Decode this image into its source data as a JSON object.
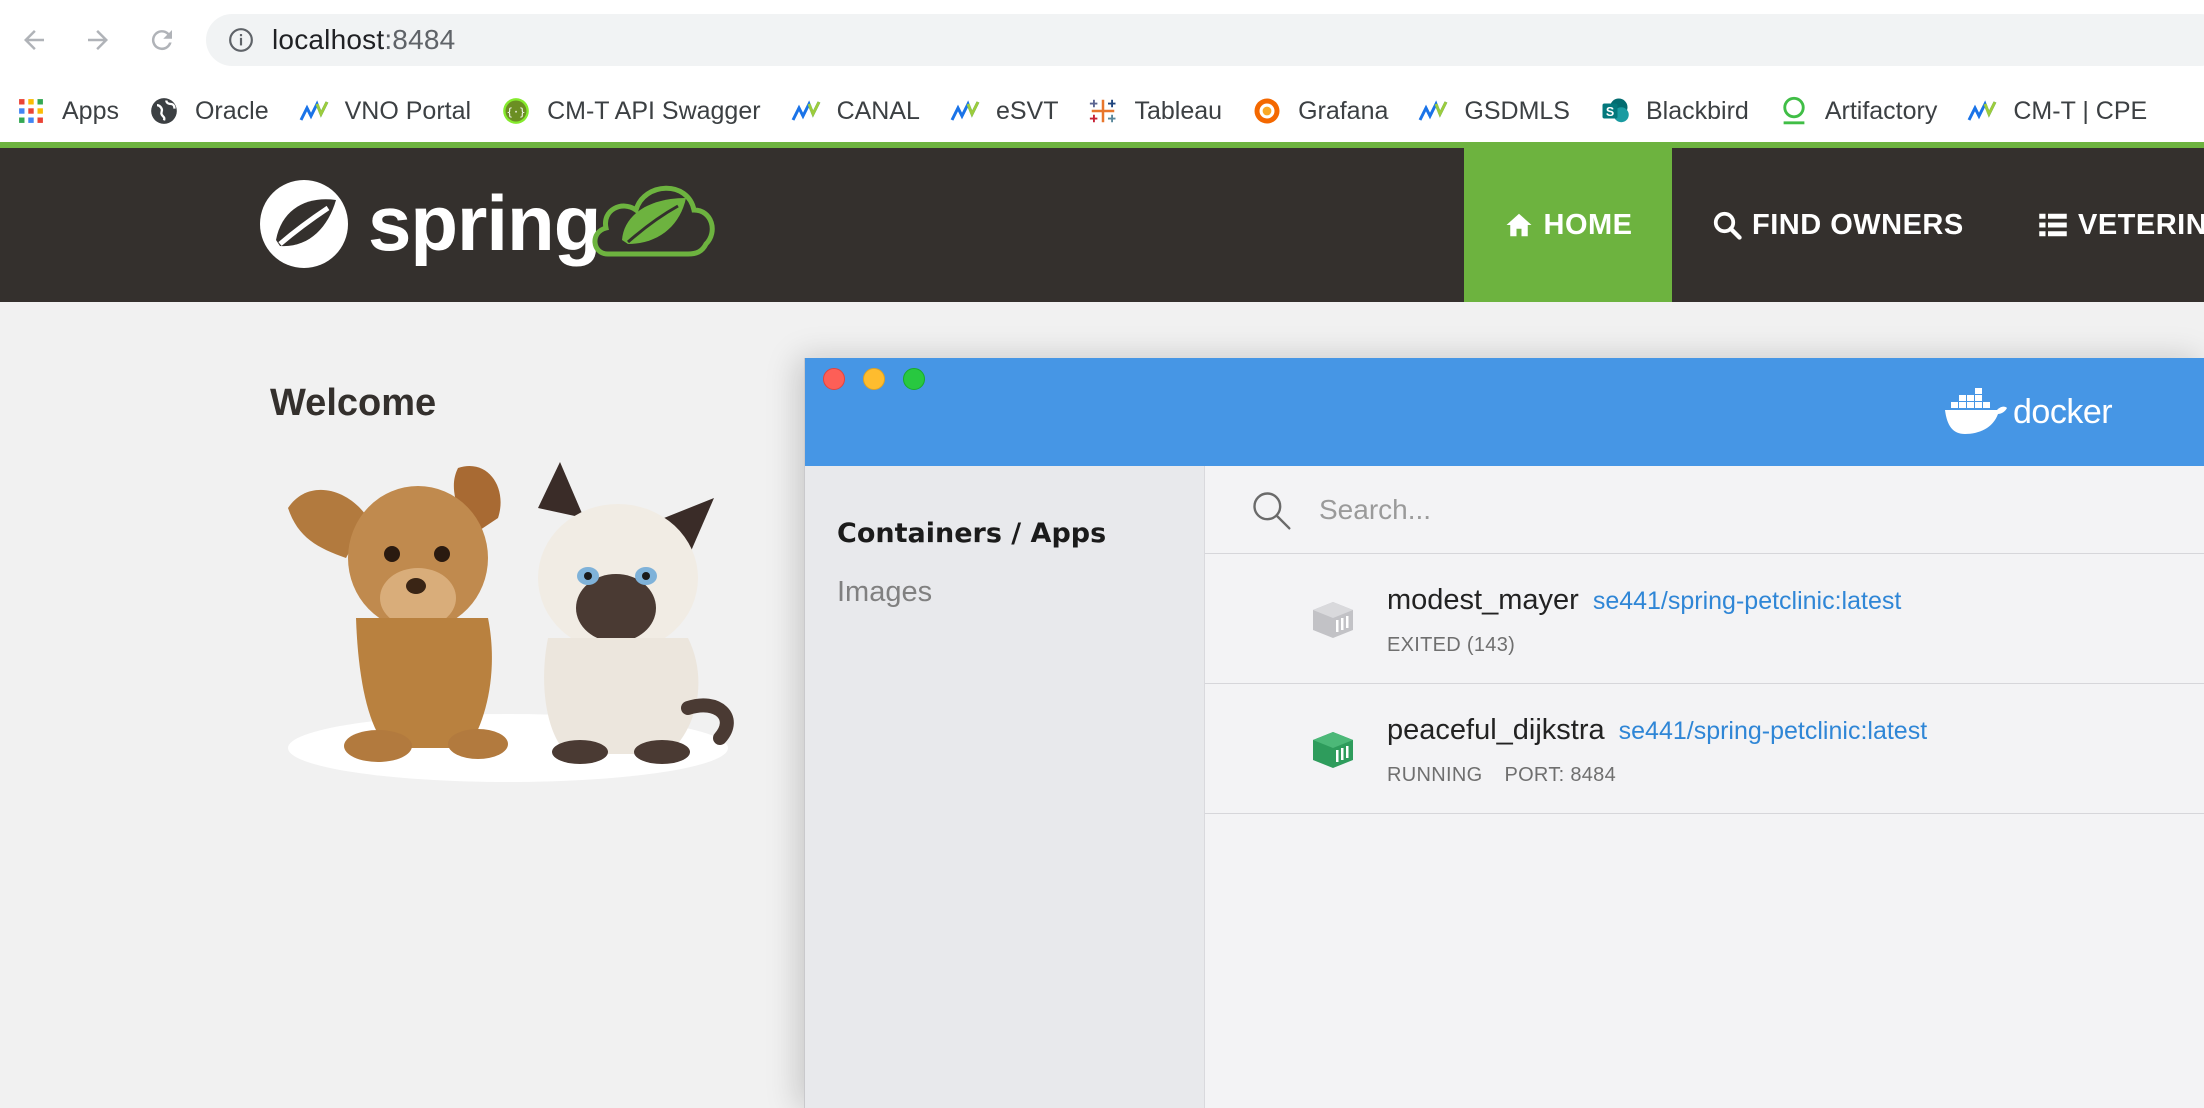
{
  "browser": {
    "url_host": "localhost",
    "url_port": ":8484",
    "bookmarks": [
      {
        "label": "Apps",
        "icon": "apps-grid-icon"
      },
      {
        "label": "Oracle",
        "icon": "globe-icon"
      },
      {
        "label": "VNO Portal",
        "icon": "wave-chart-icon"
      },
      {
        "label": "CM-T API Swagger",
        "icon": "swagger-icon"
      },
      {
        "label": "CANAL",
        "icon": "wave-chart-icon"
      },
      {
        "label": "eSVT",
        "icon": "wave-chart-icon"
      },
      {
        "label": "Tableau",
        "icon": "tableau-icon"
      },
      {
        "label": "Grafana",
        "icon": "grafana-icon"
      },
      {
        "label": "GSDMLS",
        "icon": "wave-chart-icon"
      },
      {
        "label": "Blackbird",
        "icon": "sharepoint-icon"
      },
      {
        "label": "Artifactory",
        "icon": "artifactory-icon"
      },
      {
        "label": "CM-T | CPE",
        "icon": "wave-chart-icon"
      }
    ]
  },
  "spring": {
    "logo_text": "spring",
    "nav": {
      "home": "HOME",
      "find_owners": "FIND OWNERS",
      "veterinarians": "VETERINA"
    },
    "welcome": "Welcome",
    "colors": {
      "accent": "#6db33f",
      "header": "#34302d"
    }
  },
  "docker": {
    "logo_text": "docker",
    "sidebar": {
      "containers": "Containers / Apps",
      "images": "Images"
    },
    "search": {
      "placeholder": "Search..."
    },
    "containers": [
      {
        "name": "modest_mayer",
        "image": "se441/spring-petclinic:latest",
        "status": "EXITED (143)",
        "port": "",
        "state": "exited",
        "color": "#b9b9bd"
      },
      {
        "name": "peaceful_dijkstra",
        "image": "se441/spring-petclinic:latest",
        "status": "RUNNING",
        "port": "PORT: 8484",
        "state": "running",
        "color": "#2e9c5c"
      }
    ],
    "colors": {
      "titlebar": "#4696e5",
      "link": "#2f86d6"
    }
  }
}
